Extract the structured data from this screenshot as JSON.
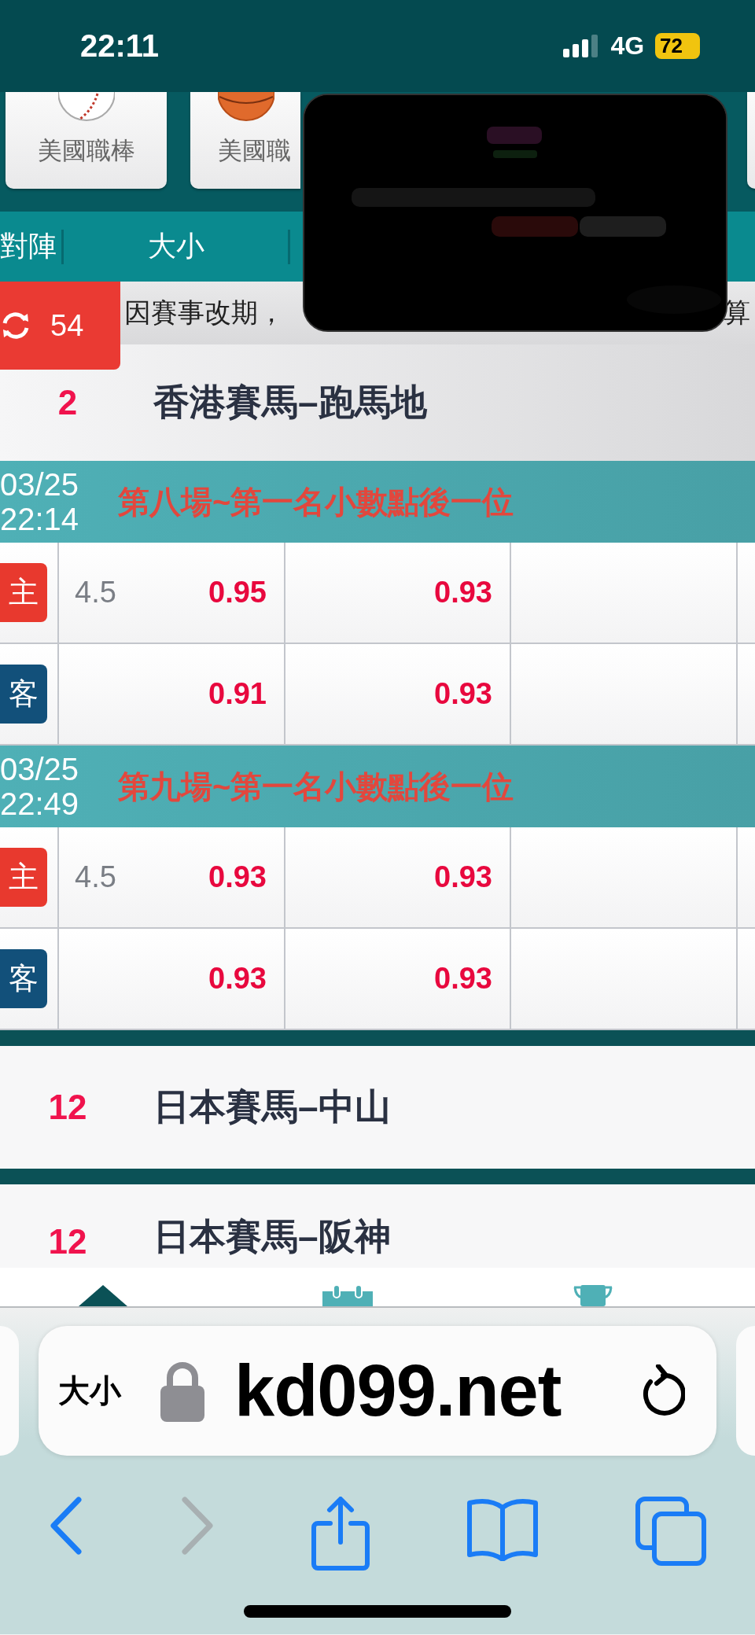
{
  "status_bar": {
    "time": "22:11",
    "network": "4G",
    "battery": "72"
  },
  "sport_cards": [
    {
      "label": "美國職棒"
    },
    {
      "label": "美國職"
    }
  ],
  "tabs": [
    {
      "label": "對陣"
    },
    {
      "label": "大小"
    }
  ],
  "notice": {
    "text": "因賽事改期，",
    "tail": "算"
  },
  "refresh_badge": {
    "count": "54"
  },
  "leagues": [
    {
      "count": "2",
      "name": "香港賽馬–跑馬地",
      "expanded": true,
      "races": [
        {
          "date": "03/25",
          "time": "22:14",
          "title": "第八場~第一名小數點後一位",
          "rows": [
            {
              "kind": "home",
              "side": "主",
              "line": "4.5",
              "odds_1": "0.95",
              "odds_2": "0.93"
            },
            {
              "kind": "away",
              "side": "客",
              "odds_1": "0.91",
              "odds_2": "0.93"
            }
          ]
        },
        {
          "date": "03/25",
          "time": "22:49",
          "title": "第九場~第一名小數點後一位",
          "rows": [
            {
              "kind": "home",
              "side": "主",
              "line": "4.5",
              "odds_1": "0.93",
              "odds_2": "0.93"
            },
            {
              "kind": "away",
              "side": "客",
              "odds_1": "0.93",
              "odds_2": "0.93"
            }
          ]
        }
      ]
    },
    {
      "count": "12",
      "name": "日本賽馬–中山",
      "expanded": false
    },
    {
      "count": "12",
      "name": "日本賽馬–阪神",
      "expanded": false
    }
  ],
  "browser": {
    "reader_label": "大小",
    "url": "kd099.net"
  }
}
